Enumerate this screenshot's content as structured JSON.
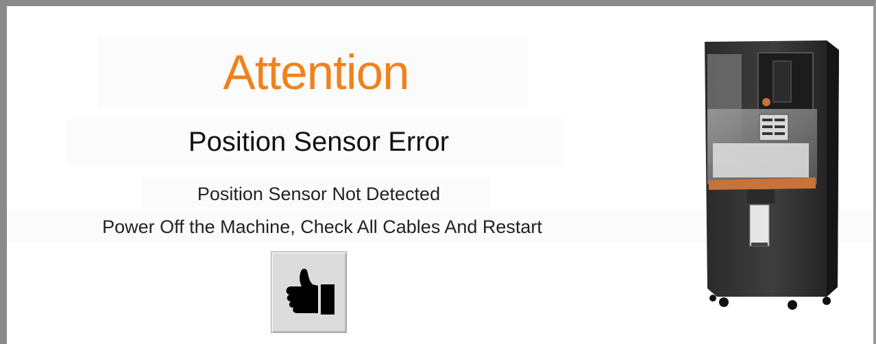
{
  "dialog": {
    "title": "Attention",
    "subtitle": "Position Sensor Error",
    "message_line_1": "Position Sensor Not Detected",
    "message_line_2": "Power Off the Machine, Check All Cables And Restart",
    "confirm_icon": "thumbs-up-icon",
    "machine_image": "machine-illustration"
  },
  "colors": {
    "title": "#f0821e",
    "frame": "#8a8a8a",
    "button_bg": "#dcdcdc",
    "machine_accent": "#c8733a"
  }
}
